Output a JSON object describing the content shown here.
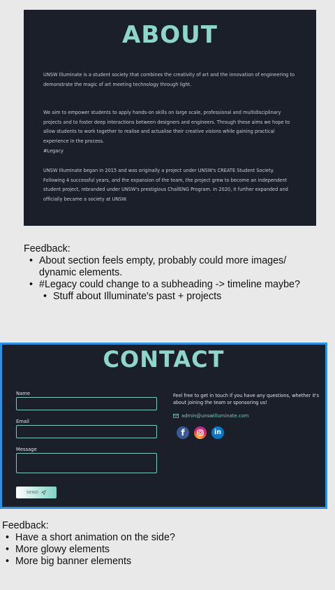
{
  "about": {
    "title": "ABOUT",
    "paragraphs": [
      "UNSW Illuminate is a student society that combines the creativity of art and the innovation of engineering to demonstrate the magic of art meeting technology through light.",
      "We aim to empower students to apply hands-on skills on large scale, professional and multidisciplinary projects and to foster deep interactions between designers and engineers. Through these aims we hope to allow students to work together to realise and actualise their creative visions while gaining practical experience in the process.",
      "#Legacy",
      "UNSW Illuminate began in 2015 and was originally a project under UNSW's CREATE Student Society. Following 4 successful years, and the expansion of the team, the project grew to become an independent student project, rebranded under UNSW's prestigious ChallENG Program. In 2020, it further expanded and officially became a society at UNSW."
    ]
  },
  "feedback_about": {
    "heading": "Feedback:",
    "items": [
      "About section feels empty, probably could more images/ dynamic elements.",
      "#Legacy could change to a subheading -> timeline maybe?"
    ],
    "subitems": [
      "Stuff about Illuminate's past + projects"
    ]
  },
  "contact": {
    "title": "CONTACT",
    "name_label": "Name",
    "email_label": "Email",
    "message_label": "Message",
    "send_label": "SEND",
    "info": "Feel free to get in touch if you have any questions, whether it's about joining the team or sponsoring us!",
    "email": "admin@unswilluminate.com",
    "social_icons": [
      "facebook-icon",
      "instagram-icon",
      "linkedin-icon"
    ],
    "social_labels": {
      "facebook": "f",
      "linkedin": "in"
    },
    "accent": "#8fd6c8"
  },
  "feedback_contact": {
    "heading": "Feedback:",
    "items": [
      "Have a short animation on the side?",
      "More glowy elements",
      "More big banner elements"
    ]
  }
}
